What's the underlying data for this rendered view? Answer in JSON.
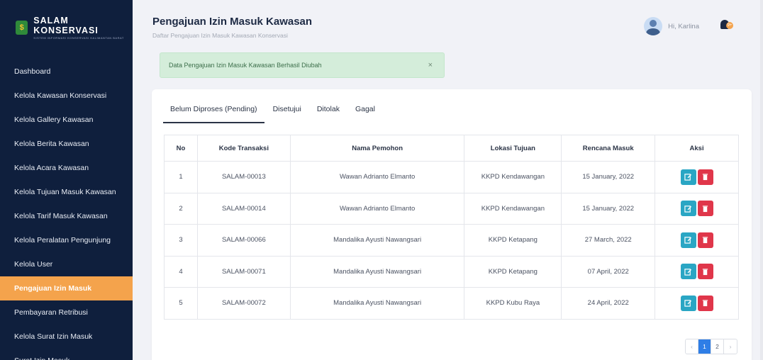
{
  "brand": {
    "title": "SALAM KONSERVASI",
    "subtitle": "SISTEM INFORMASI KONSERVASI KALIMANTAN BARAT",
    "logo": "$"
  },
  "sidebar": {
    "items": [
      {
        "label": "Dashboard"
      },
      {
        "label": "Kelola Kawasan Konservasi"
      },
      {
        "label": "Kelola Gallery Kawasan"
      },
      {
        "label": "Kelola Berita Kawasan"
      },
      {
        "label": "Kelola Acara Kawasan"
      },
      {
        "label": "Kelola Tujuan Masuk Kawasan"
      },
      {
        "label": "Kelola Tarif Masuk Kawasan"
      },
      {
        "label": "Kelola Peralatan Pengunjung"
      },
      {
        "label": "Kelola User"
      },
      {
        "label": "Pengajuan Izin Masuk"
      },
      {
        "label": "Pembayaran Retribusi"
      },
      {
        "label": "Kelola Surat Izin Masuk"
      },
      {
        "label": "Surat Izin Masuk"
      }
    ],
    "active_index": 9
  },
  "header": {
    "title": "Pengajuan Izin Masuk Kawasan",
    "subtitle": "Daftar Pengajuan Izin Masuk Kawasan Konservasi",
    "greeting": "Hi, Karlina",
    "notif_count": "9+"
  },
  "alert": {
    "message": "Data Pengajuan Izin Masuk Kawasan Berhasil Diubah",
    "close": "×"
  },
  "tabs": [
    {
      "label": "Belum Diproses (Pending)"
    },
    {
      "label": "Disetujui"
    },
    {
      "label": "Ditolak"
    },
    {
      "label": "Gagal"
    }
  ],
  "table": {
    "columns": [
      "No",
      "Kode Transaksi",
      "Nama Pemohon",
      "Lokasi Tujuan",
      "Rencana Masuk",
      "Aksi"
    ],
    "rows": [
      {
        "no": "1",
        "kode": "SALAM-00013",
        "nama": "Wawan Adrianto Elmanto",
        "lokasi": "KKPD Kendawangan",
        "rencana": "15 January, 2022"
      },
      {
        "no": "2",
        "kode": "SALAM-00014",
        "nama": "Wawan Adrianto Elmanto",
        "lokasi": "KKPD Kendawangan",
        "rencana": "15 January, 2022"
      },
      {
        "no": "3",
        "kode": "SALAM-00066",
        "nama": "Mandalika Ayusti Nawangsari",
        "lokasi": "KKPD Ketapang",
        "rencana": "27 March, 2022"
      },
      {
        "no": "4",
        "kode": "SALAM-00071",
        "nama": "Mandalika Ayusti Nawangsari",
        "lokasi": "KKPD Ketapang",
        "rencana": "07 April, 2022"
      },
      {
        "no": "5",
        "kode": "SALAM-00072",
        "nama": "Mandalika Ayusti Nawangsari",
        "lokasi": "KKPD Kubu Raya",
        "rencana": "24 April, 2022"
      }
    ]
  },
  "pagination": {
    "prev": "‹",
    "pages": [
      "1",
      "2"
    ],
    "next": "›",
    "current": "1"
  },
  "colors": {
    "sidebar_bg": "#0f1f3d",
    "accent_orange": "#f4a34c",
    "edit_btn": "#2aa6c4",
    "delete_btn": "#e0364a",
    "page_active": "#2f7ee6"
  }
}
